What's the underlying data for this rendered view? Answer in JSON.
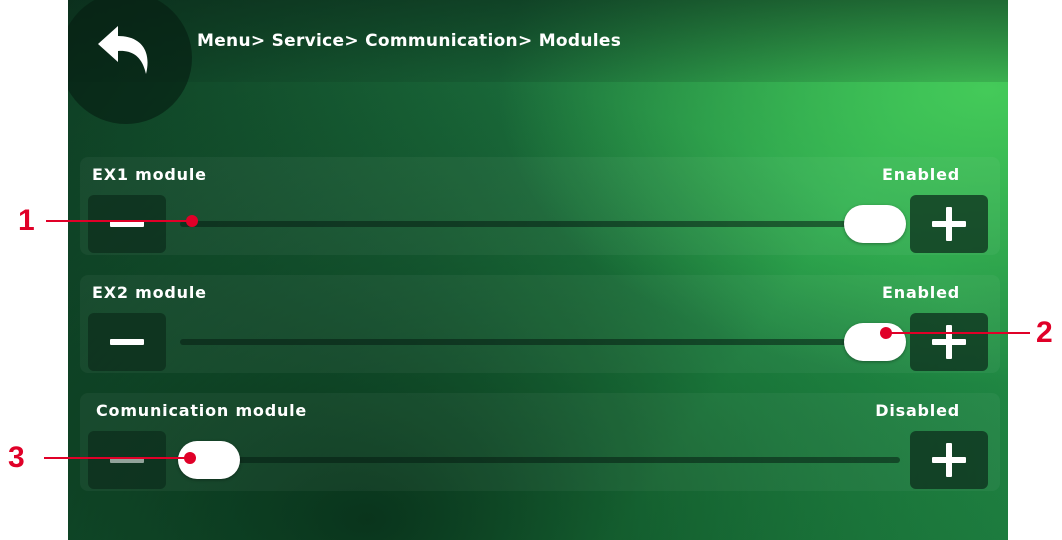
{
  "header": {
    "breadcrumb": "Menu> Service> Communication> Modules",
    "back_icon": "back-arrow-icon"
  },
  "modules": [
    {
      "label": "EX1 module",
      "status": "Enabled",
      "state": 1
    },
    {
      "label": "EX2 module",
      "status": "Enabled",
      "state": 1
    },
    {
      "label": "Comunication module",
      "status": "Disabled",
      "state": 0
    }
  ],
  "callouts": [
    "1",
    "2",
    "3"
  ],
  "colors": {
    "background_green": "#1f8a45",
    "callout_red": "#e00028",
    "text": "#ffffff"
  }
}
